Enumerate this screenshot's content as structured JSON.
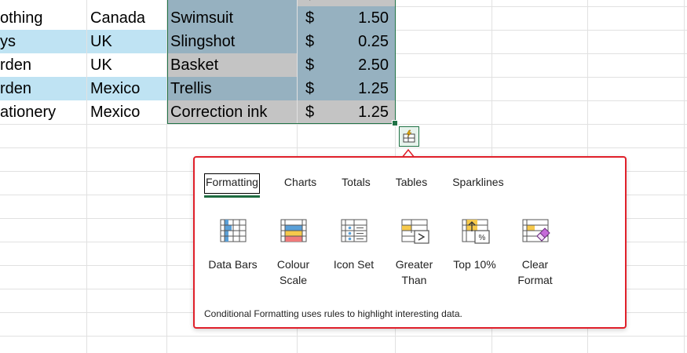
{
  "spreadsheet": {
    "rows": [
      {
        "category": "",
        "country": "",
        "product": "",
        "currency": "$",
        "amount": "",
        "band": "white"
      },
      {
        "category": "othing",
        "country": "Canada",
        "product": "Swimsuit",
        "currency": "$",
        "amount": "1.50",
        "band": "white"
      },
      {
        "category": "ys",
        "country": "UK",
        "product": "Slingshot",
        "currency": "$",
        "amount": "0.25",
        "band": "blue"
      },
      {
        "category": "rden",
        "country": "UK",
        "product": "Basket",
        "currency": "$",
        "amount": "2.50",
        "band": "white"
      },
      {
        "category": "rden",
        "country": "Mexico",
        "product": "Trellis",
        "currency": "$",
        "amount": "1.25",
        "band": "blue"
      },
      {
        "category": "ationery",
        "country": "Mexico",
        "product": "Correction ink",
        "currency": "$",
        "amount": "1.25",
        "band": "white"
      }
    ]
  },
  "quick_analysis": {
    "tabs": [
      {
        "label": "Formatting",
        "active": true
      },
      {
        "label": "Charts",
        "active": false
      },
      {
        "label": "Totals",
        "active": false
      },
      {
        "label": "Tables",
        "active": false
      },
      {
        "label": "Sparklines",
        "active": false
      }
    ],
    "tools": [
      {
        "label": "Data Bars",
        "icon": "data-bars-icon"
      },
      {
        "label": "Colour\nScale",
        "icon": "colour-scale-icon"
      },
      {
        "label": "Icon Set",
        "icon": "icon-set-icon"
      },
      {
        "label": "Greater\nThan",
        "icon": "greater-than-icon"
      },
      {
        "label": "Top 10%",
        "icon": "top-ten-icon"
      },
      {
        "label": "Clear\nFormat",
        "icon": "clear-format-icon"
      }
    ],
    "description": "Conditional Formatting uses rules to highlight interesting data.",
    "colors": {
      "border": "#e0202a",
      "accent": "#1e6b40"
    }
  }
}
